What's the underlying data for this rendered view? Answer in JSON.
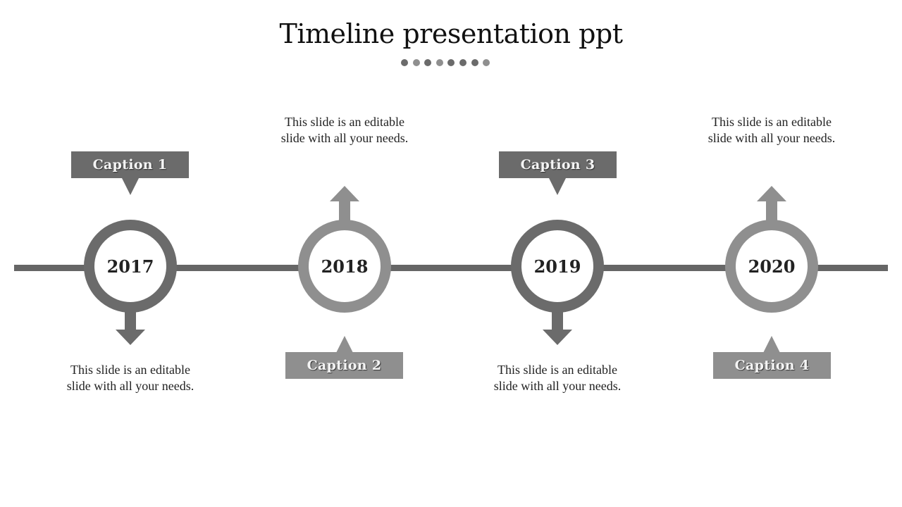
{
  "title": "Timeline presentation ppt",
  "colors": {
    "dark": "#6b6b6b",
    "light": "#8f8f8f",
    "line": "#666666"
  },
  "dots": [
    "dark",
    "light",
    "dark",
    "light",
    "dark",
    "dark",
    "dark",
    "light"
  ],
  "milestones": [
    {
      "year": "2017",
      "caption": "Caption  1",
      "description": "This slide is an editable slide with all your needs.",
      "tone": "dark",
      "arrow": "down-arrow-icon"
    },
    {
      "year": "2018",
      "caption": "Caption  2",
      "description": "This slide is an editable slide with all your needs.",
      "tone": "light",
      "arrow": "up-arrow-icon"
    },
    {
      "year": "2019",
      "caption": "Caption  3",
      "description": "This slide is an editable slide with all your needs.",
      "tone": "dark",
      "arrow": "down-arrow-icon"
    },
    {
      "year": "2020",
      "caption": "Caption  4",
      "description": "This slide is an editable slide with all your needs.",
      "tone": "light",
      "arrow": "up-arrow-icon"
    }
  ]
}
